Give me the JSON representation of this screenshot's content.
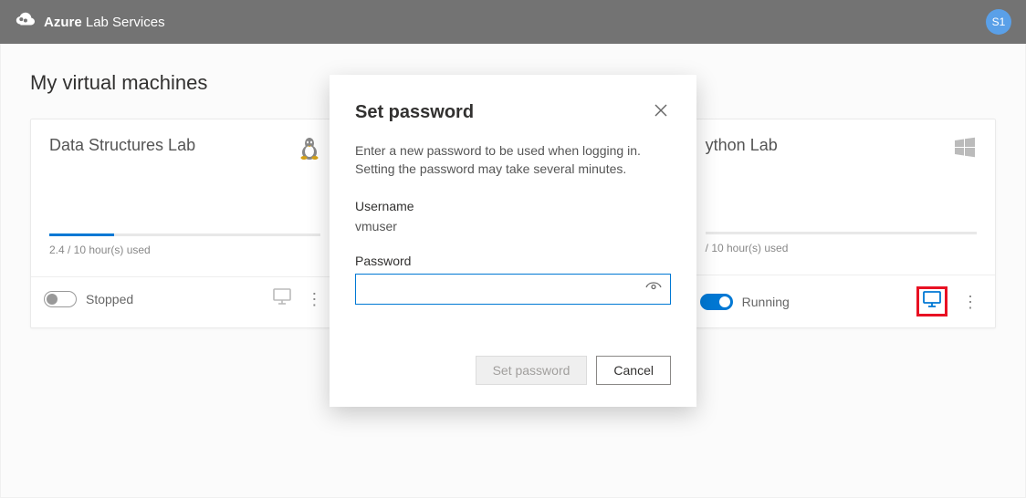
{
  "header": {
    "brand_bold": "Azure",
    "brand_rest": " Lab Services",
    "avatar_initials": "S1"
  },
  "page": {
    "title": "My virtual machines"
  },
  "cards": [
    {
      "title": "Data Structures Lab",
      "os": "linux",
      "progress_pct": 24,
      "usage_text": "2.4 / 10 hour(s) used",
      "toggle_on": false,
      "status": "Stopped",
      "connect_enabled": false,
      "highlighted_connect": false
    },
    {
      "title": "ython Lab",
      "os": "windows",
      "progress_pct": 0,
      "usage_text": " / 10 hour(s) used",
      "toggle_on": true,
      "status": "Running",
      "connect_enabled": true,
      "highlighted_connect": true
    }
  ],
  "modal": {
    "title": "Set password",
    "description": "Enter a new password to be used when logging in. Setting the password may take several minutes.",
    "username_label": "Username",
    "username_value": "vmuser",
    "password_label": "Password",
    "password_value": "",
    "password_placeholder": "",
    "set_button": "Set password",
    "cancel_button": "Cancel"
  }
}
